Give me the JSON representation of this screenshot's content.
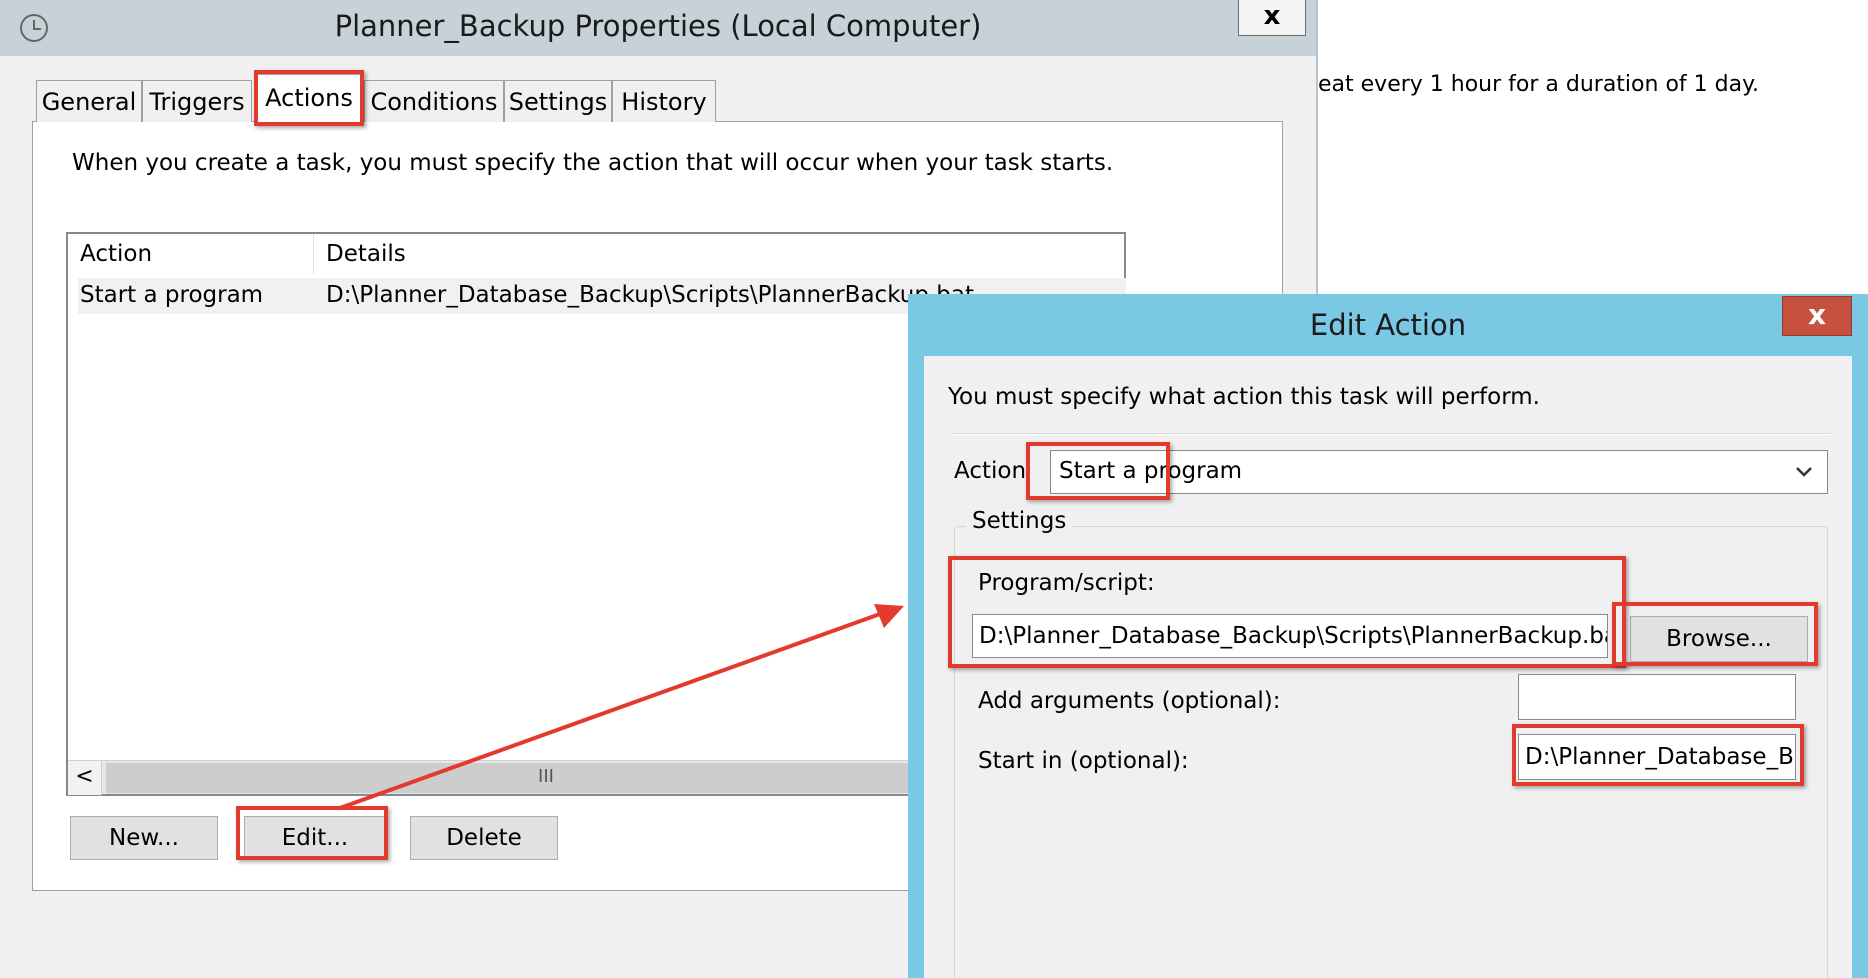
{
  "props_window": {
    "title": "Planner_Backup Properties (Local Computer)",
    "close_label": "x",
    "tabs": [
      {
        "label": "General"
      },
      {
        "label": "Triggers"
      },
      {
        "label": "Actions"
      },
      {
        "label": "Conditions"
      },
      {
        "label": "Settings"
      },
      {
        "label": "History"
      }
    ],
    "intro": "When you create a task, you must specify the action that will occur when your task starts.",
    "table": {
      "columns": [
        "Action",
        "Details"
      ],
      "rows": [
        {
          "action": "Start a program",
          "details": "D:\\Planner_Database_Backup\\Scripts\\PlannerBackup.bat"
        }
      ]
    },
    "scroll_left": "<",
    "scroll_thumb": "III",
    "buttons": {
      "new": "New...",
      "edit": "Edit...",
      "delete": "Delete"
    }
  },
  "background_text": "eat every 1 hour for a duration of 1 day.",
  "edit_action": {
    "title": "Edit Action",
    "close_label": "x",
    "intro": "You must specify what action this task will perform.",
    "action_label": "Action",
    "action_value": "Start a program",
    "settings_label": "Settings",
    "program_label": "Program/script:",
    "program_value": "D:\\Planner_Database_Backup\\Scripts\\PlannerBackup.bat",
    "browse_label": "Browse...",
    "args_label": "Add arguments (optional):",
    "args_value": "",
    "startin_label": "Start in (optional):",
    "startin_value": "D:\\Planner_Database_Ba"
  },
  "colors": {
    "highlight": "#e23a2c",
    "dialog_frame": "#7ac8e4",
    "close_button": "#c7503f"
  }
}
